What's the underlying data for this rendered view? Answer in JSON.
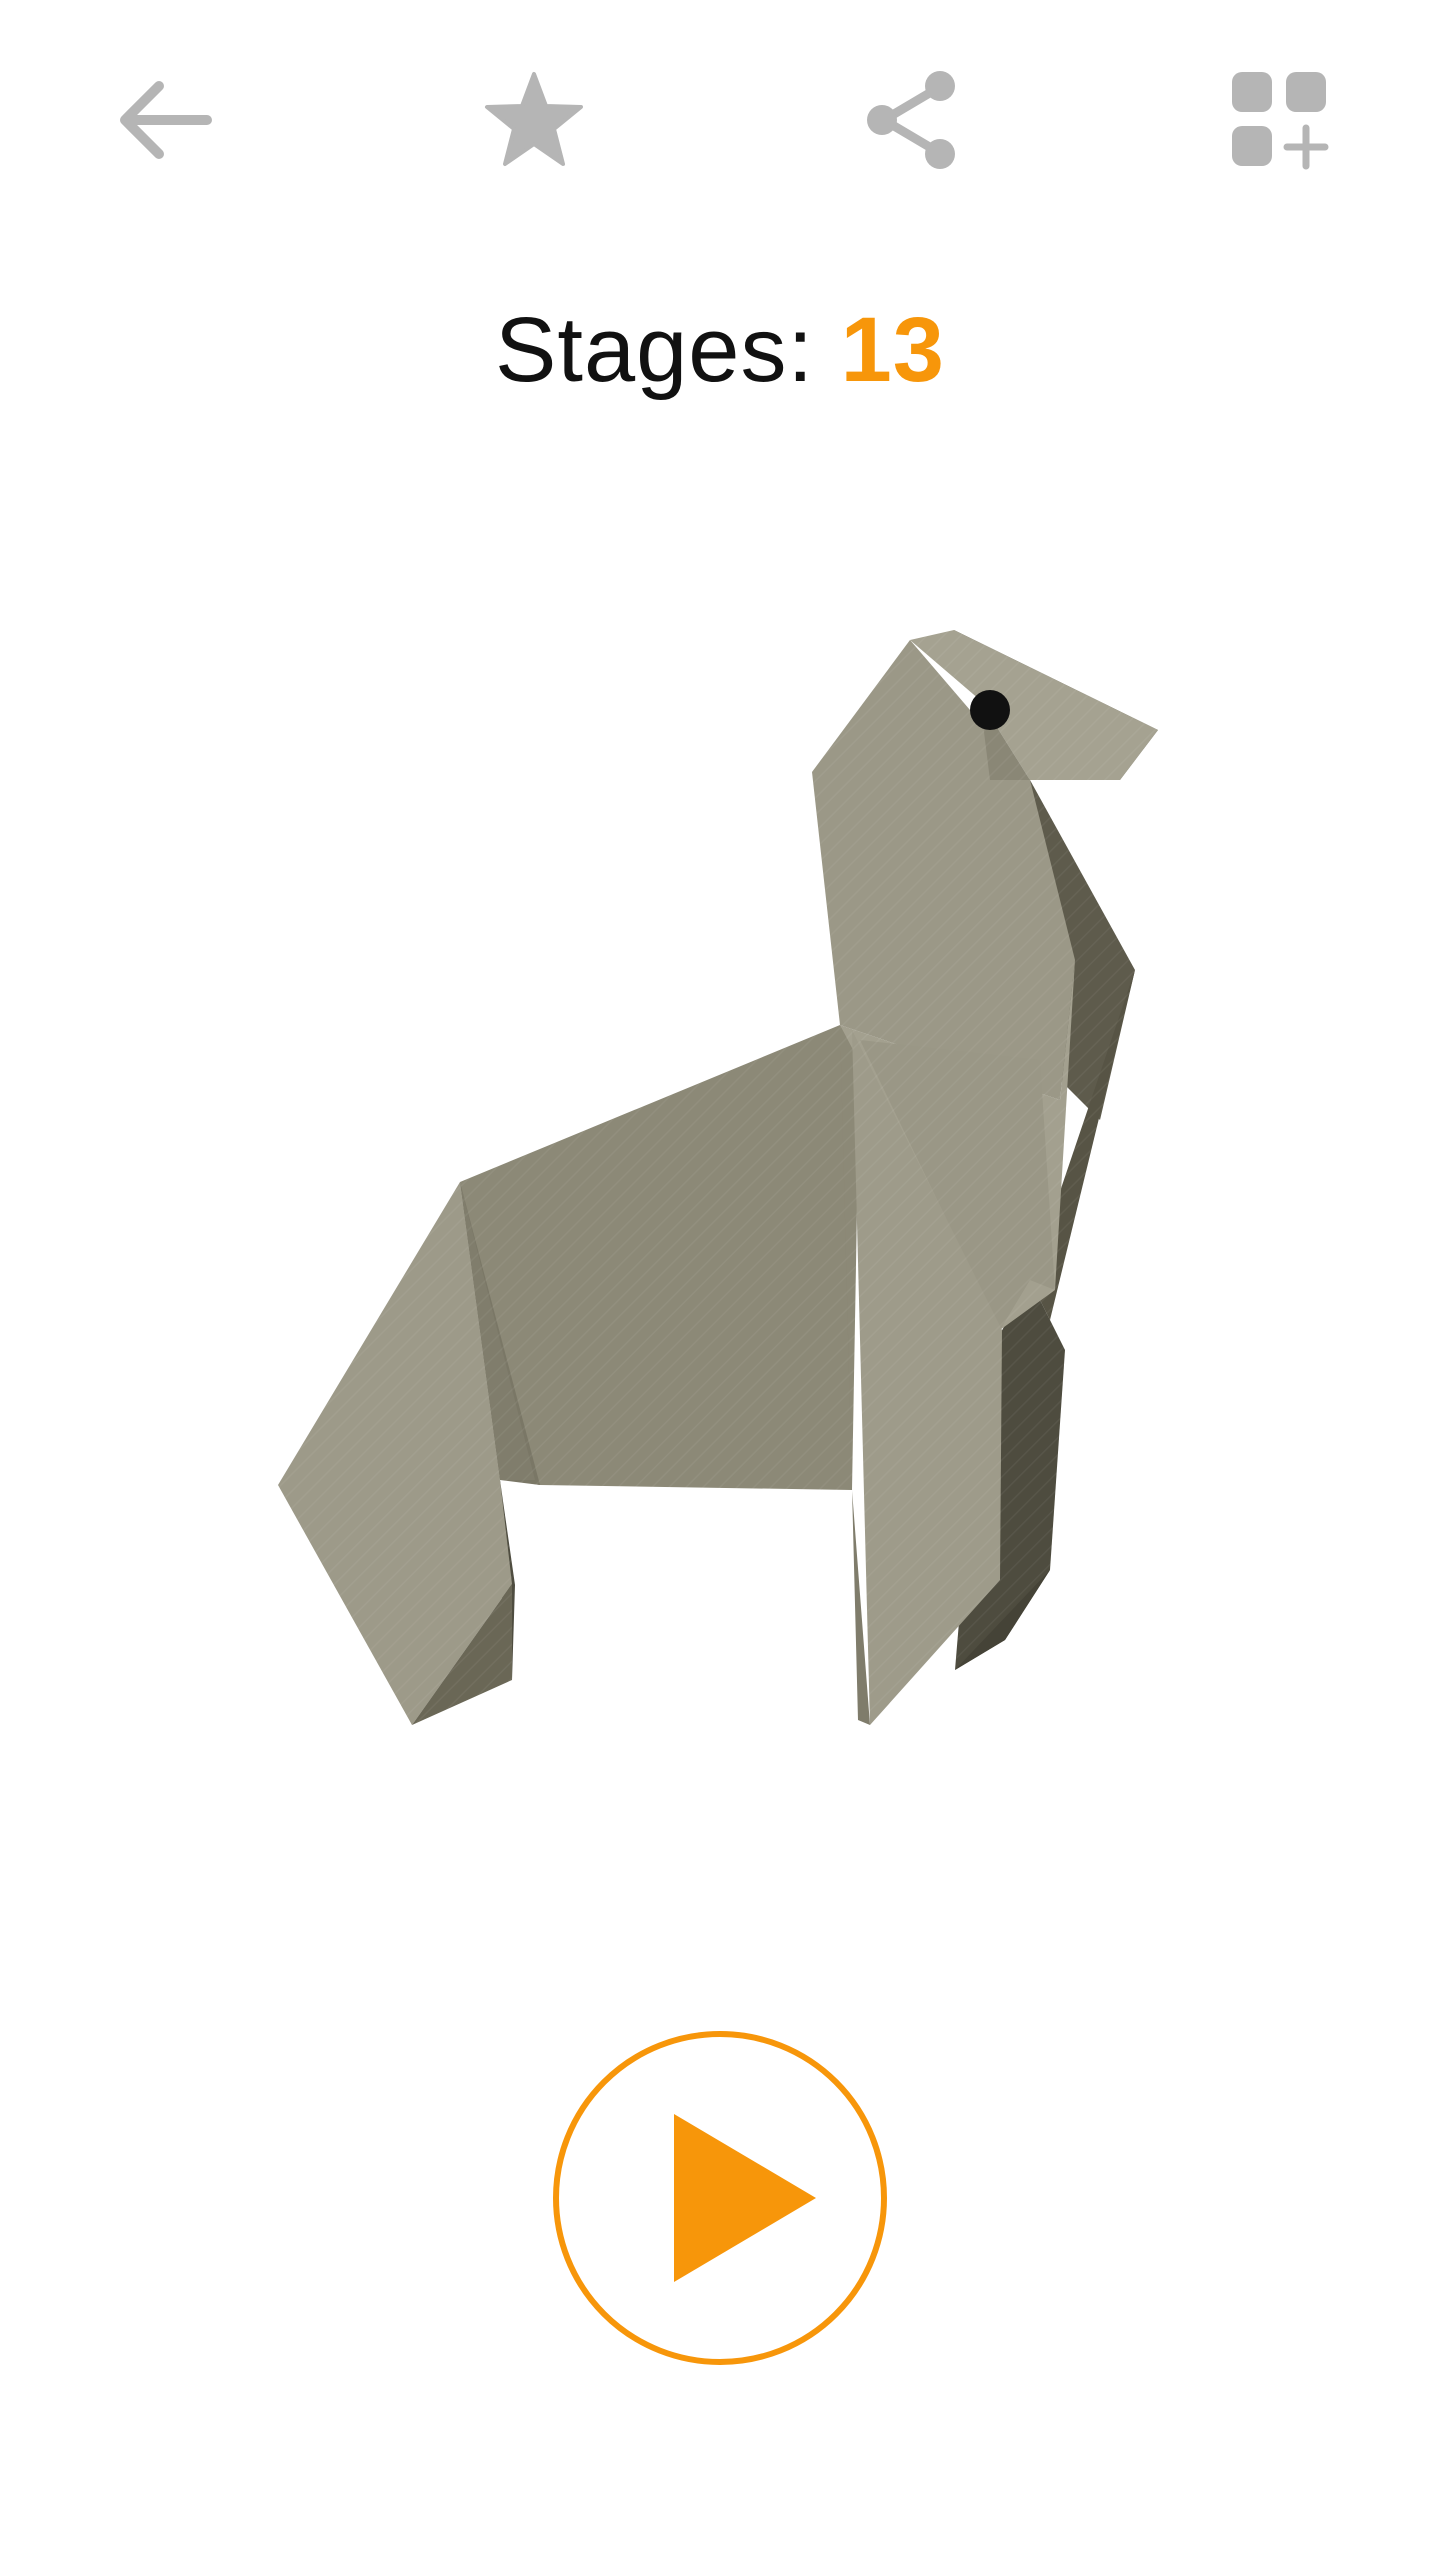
{
  "toolbar": {
    "back": {
      "icon": "arrow-left-icon"
    },
    "favorite": {
      "icon": "star-icon"
    },
    "share": {
      "icon": "share-icon"
    },
    "add": {
      "icon": "add-widget-icon"
    },
    "icon_color": "#B5B5B5"
  },
  "stages": {
    "label": "Stages: ",
    "count": "13",
    "count_color": "#F7960A"
  },
  "model": {
    "subject": "origami-camel-illustration"
  },
  "play": {
    "icon": "play-icon",
    "color": "#F7960A"
  }
}
